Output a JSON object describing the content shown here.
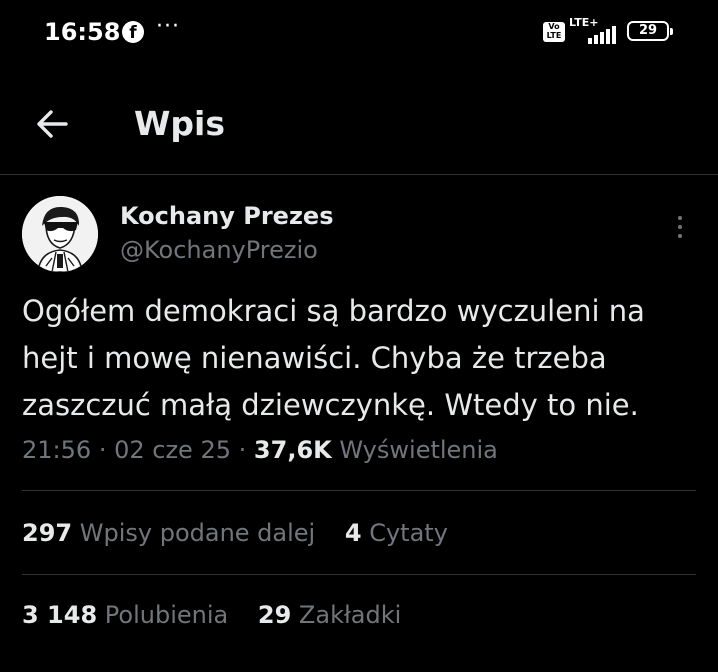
{
  "status_bar": {
    "time": "16:58",
    "app_icon": "facebook-icon",
    "more": "···",
    "volte": "Vo\nLTE",
    "network": "LTE+",
    "battery": "29"
  },
  "header": {
    "back_icon": "arrow-left-icon",
    "title": "Wpis"
  },
  "tweet": {
    "author_name": "Kochany Prezes",
    "author_handle": "@KochanyPrezio",
    "more_icon": "vertical-dots-icon",
    "text": "Ogółem demokraci są bardzo wyczuleni na\nhejt i mowę nienawiści. Chyba że trzeba\nzaszczuć małą dziewczynkę. Wtedy to nie.",
    "time": "21:56",
    "sep": "·",
    "date": "02 cze 25",
    "views_count": "37,6K",
    "views_label": "Wyświetlenia"
  },
  "stats_row1": [
    {
      "count": "297",
      "label": "Wpisy podane dalej"
    },
    {
      "count": "4",
      "label": "Cytaty"
    }
  ],
  "stats_row2": [
    {
      "count": "3 148",
      "label": "Polubienia"
    },
    {
      "count": "29",
      "label": "Zakładki"
    }
  ],
  "colors": {
    "background": "#000000",
    "text_primary": "#e7e9ea",
    "text_secondary": "#71767b",
    "divider": "#2f3336"
  }
}
